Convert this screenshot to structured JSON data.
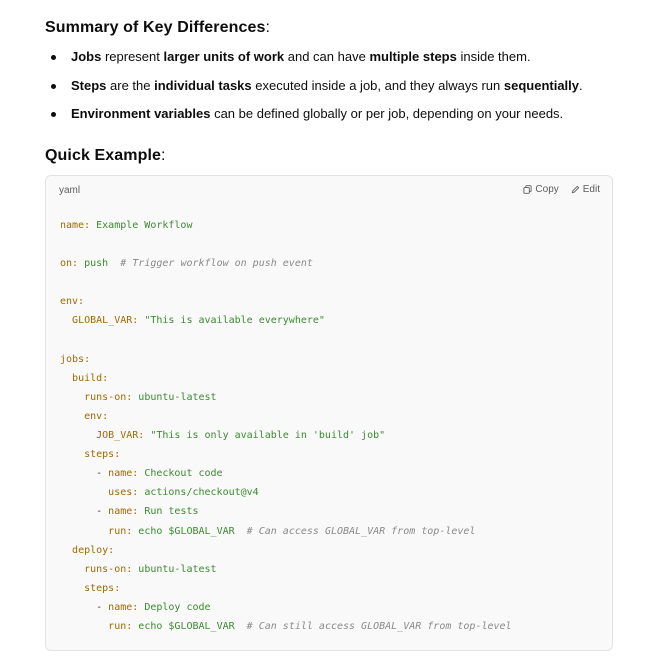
{
  "summary": {
    "title": "Summary of Key Differences",
    "colon": ":",
    "bullets": [
      {
        "parts": [
          {
            "t": "Jobs",
            "b": true
          },
          {
            "t": " represent ",
            "b": false
          },
          {
            "t": "larger units of work",
            "b": true
          },
          {
            "t": " and can have ",
            "b": false
          },
          {
            "t": "multiple steps",
            "b": true
          },
          {
            "t": " inside them.",
            "b": false
          }
        ]
      },
      {
        "parts": [
          {
            "t": "Steps",
            "b": true
          },
          {
            "t": " are the ",
            "b": false
          },
          {
            "t": "individual tasks",
            "b": true
          },
          {
            "t": " executed inside a job, and they always run ",
            "b": false
          },
          {
            "t": "sequentially",
            "b": true
          },
          {
            "t": ".",
            "b": false
          }
        ]
      },
      {
        "parts": [
          {
            "t": "Environment variables",
            "b": true
          },
          {
            "t": " can be defined globally or per job, depending on your needs.",
            "b": false
          }
        ]
      }
    ]
  },
  "quick": {
    "title": "Quick Example",
    "colon": ":"
  },
  "code": {
    "language": "yaml",
    "copy_label": "Copy",
    "edit_label": "Edit",
    "lines": [
      [
        {
          "c": "k",
          "t": "name:"
        },
        {
          "c": "",
          "t": " "
        },
        {
          "c": "v",
          "t": "Example Workflow"
        }
      ],
      [],
      [
        {
          "c": "k",
          "t": "on:"
        },
        {
          "c": "",
          "t": " "
        },
        {
          "c": "v",
          "t": "push"
        },
        {
          "c": "",
          "t": "  "
        },
        {
          "c": "c",
          "t": "# Trigger workflow on push event"
        }
      ],
      [],
      [
        {
          "c": "k",
          "t": "env:"
        }
      ],
      [
        {
          "c": "",
          "t": "  "
        },
        {
          "c": "k",
          "t": "GLOBAL_VAR:"
        },
        {
          "c": "",
          "t": " "
        },
        {
          "c": "s",
          "t": "\"This is available everywhere\""
        }
      ],
      [],
      [
        {
          "c": "k",
          "t": "jobs:"
        }
      ],
      [
        {
          "c": "",
          "t": "  "
        },
        {
          "c": "k",
          "t": "build:"
        }
      ],
      [
        {
          "c": "",
          "t": "    "
        },
        {
          "c": "k",
          "t": "runs-on:"
        },
        {
          "c": "",
          "t": " "
        },
        {
          "c": "v",
          "t": "ubuntu-latest"
        }
      ],
      [
        {
          "c": "",
          "t": "    "
        },
        {
          "c": "k",
          "t": "env:"
        }
      ],
      [
        {
          "c": "",
          "t": "      "
        },
        {
          "c": "k",
          "t": "JOB_VAR:"
        },
        {
          "c": "",
          "t": " "
        },
        {
          "c": "s",
          "t": "\"This is only available in 'build' job\""
        }
      ],
      [
        {
          "c": "",
          "t": "    "
        },
        {
          "c": "k",
          "t": "steps:"
        }
      ],
      [
        {
          "c": "",
          "t": "      - "
        },
        {
          "c": "k",
          "t": "name:"
        },
        {
          "c": "",
          "t": " "
        },
        {
          "c": "v",
          "t": "Checkout code"
        }
      ],
      [
        {
          "c": "",
          "t": "        "
        },
        {
          "c": "k",
          "t": "uses:"
        },
        {
          "c": "",
          "t": " "
        },
        {
          "c": "v",
          "t": "actions/checkout@v4"
        }
      ],
      [
        {
          "c": "",
          "t": "      - "
        },
        {
          "c": "k",
          "t": "name:"
        },
        {
          "c": "",
          "t": " "
        },
        {
          "c": "v",
          "t": "Run tests"
        }
      ],
      [
        {
          "c": "",
          "t": "        "
        },
        {
          "c": "k",
          "t": "run:"
        },
        {
          "c": "",
          "t": " "
        },
        {
          "c": "v",
          "t": "echo $GLOBAL_VAR"
        },
        {
          "c": "",
          "t": "  "
        },
        {
          "c": "c",
          "t": "# Can access GLOBAL_VAR from top-level"
        }
      ],
      [
        {
          "c": "",
          "t": "  "
        },
        {
          "c": "k",
          "t": "deploy:"
        }
      ],
      [
        {
          "c": "",
          "t": "    "
        },
        {
          "c": "k",
          "t": "runs-on:"
        },
        {
          "c": "",
          "t": " "
        },
        {
          "c": "v",
          "t": "ubuntu-latest"
        }
      ],
      [
        {
          "c": "",
          "t": "    "
        },
        {
          "c": "k",
          "t": "steps:"
        }
      ],
      [
        {
          "c": "",
          "t": "      - "
        },
        {
          "c": "k",
          "t": "name:"
        },
        {
          "c": "",
          "t": " "
        },
        {
          "c": "v",
          "t": "Deploy code"
        }
      ],
      [
        {
          "c": "",
          "t": "        "
        },
        {
          "c": "k",
          "t": "run:"
        },
        {
          "c": "",
          "t": " "
        },
        {
          "c": "v",
          "t": "echo $GLOBAL_VAR"
        },
        {
          "c": "",
          "t": "  "
        },
        {
          "c": "c",
          "t": "# Can still access GLOBAL_VAR from top-level"
        }
      ]
    ]
  },
  "icons": {
    "copy": "copy-icon",
    "edit": "edit-icon"
  },
  "colors": {
    "key": "#a06a00",
    "string": "#3a8c2f",
    "comment": "#8a8a8a",
    "code_bg": "#f9f9f9"
  }
}
